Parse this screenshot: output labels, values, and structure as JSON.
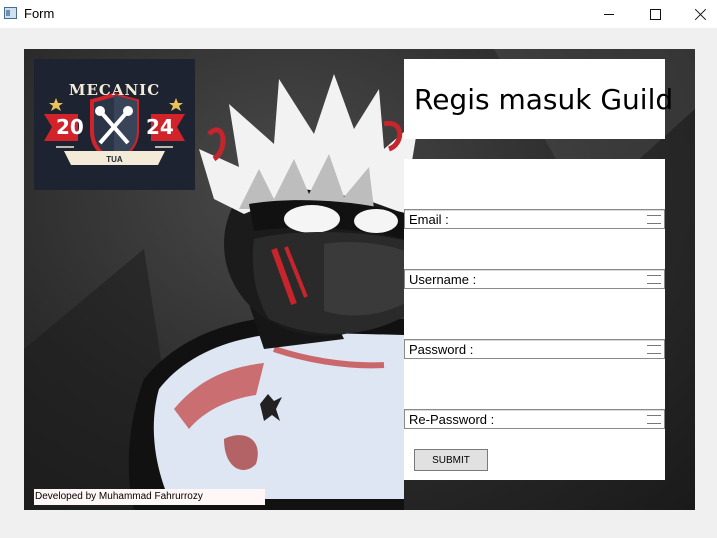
{
  "window": {
    "title": "Form",
    "icon": "window-app-icon",
    "controls": [
      "minimize-icon",
      "maximize-icon",
      "close-icon"
    ]
  },
  "logo": {
    "text_top": "MECANIC",
    "number_left": "20",
    "number_right": "24",
    "text_bottom": "TUA",
    "colors": {
      "background": "#1d2330",
      "accent": "#d2232a",
      "cream": "#f3ead8"
    }
  },
  "form": {
    "title": "Regis masuk Guild",
    "fields": [
      {
        "label": "Email :",
        "value": ""
      },
      {
        "label": "Username :",
        "value": ""
      },
      {
        "label": "Password :",
        "value": ""
      },
      {
        "label": "Re-Password :",
        "value": ""
      }
    ],
    "submit_label": "SUBMIT"
  },
  "footer": {
    "credit": "Developed by Muhammad Fahrurrozy"
  },
  "colors": {
    "window_bg": "#f0f0f0",
    "panel_bg": "#2b2b2b",
    "form_bg": "#ffffff"
  }
}
